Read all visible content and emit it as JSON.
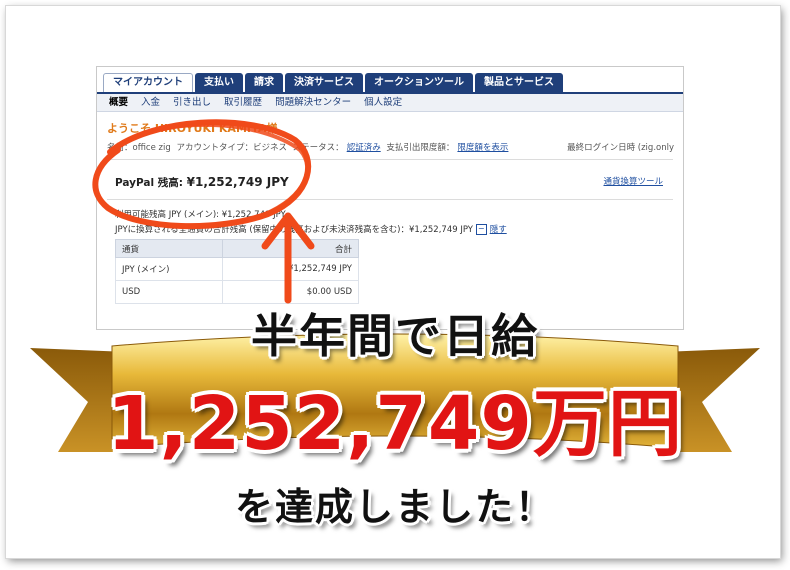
{
  "tabs": [
    "マイアカウント",
    "支払い",
    "請求",
    "決済サービス",
    "オークションツール",
    "製品とサービス"
  ],
  "subnav": [
    "概要",
    "入金",
    "引き出し",
    "取引履歴",
    "問題解決センター",
    "個人設定"
  ],
  "welcome": "ようこそ HIROYUKI KAMIYA様",
  "info": {
    "name": "名前：office zig",
    "account_type": "アカウントタイプ：ビジネス",
    "status_label": "ステータス：",
    "status_value": "認証済み",
    "limit_label": "支払引出限度額：",
    "limit_link": "限度額を表示",
    "last_login": "最終ログイン日時 (zig.only"
  },
  "balance": {
    "label": "PayPal 残高:",
    "amount": "¥1,252,749 JPY",
    "tool_link": "通貨換算ツール"
  },
  "detail": {
    "line1": "利用可能残高 JPY (メイン): ¥1,252,749 JPY",
    "line2": "JPYに換算される全通貨の合計残高 (保留中の残高および未決済残高を含む)：¥1,252,749 JPY",
    "minus": "−",
    "hide": "隠す"
  },
  "table": {
    "headers": [
      "通貨",
      "合計"
    ],
    "rows": [
      [
        "JPY (メイン)",
        "¥1,252,749 JPY"
      ],
      [
        "USD",
        "$0.00 USD"
      ]
    ]
  },
  "headline": {
    "line1": "半年間で日給",
    "line2": "1,252,749万円",
    "line3": "を達成しました！"
  },
  "colors": {
    "nav": "#1f3f7a",
    "accent_red": "#e11414",
    "circle": "#f04a1a",
    "gold": "#d8a92a"
  }
}
